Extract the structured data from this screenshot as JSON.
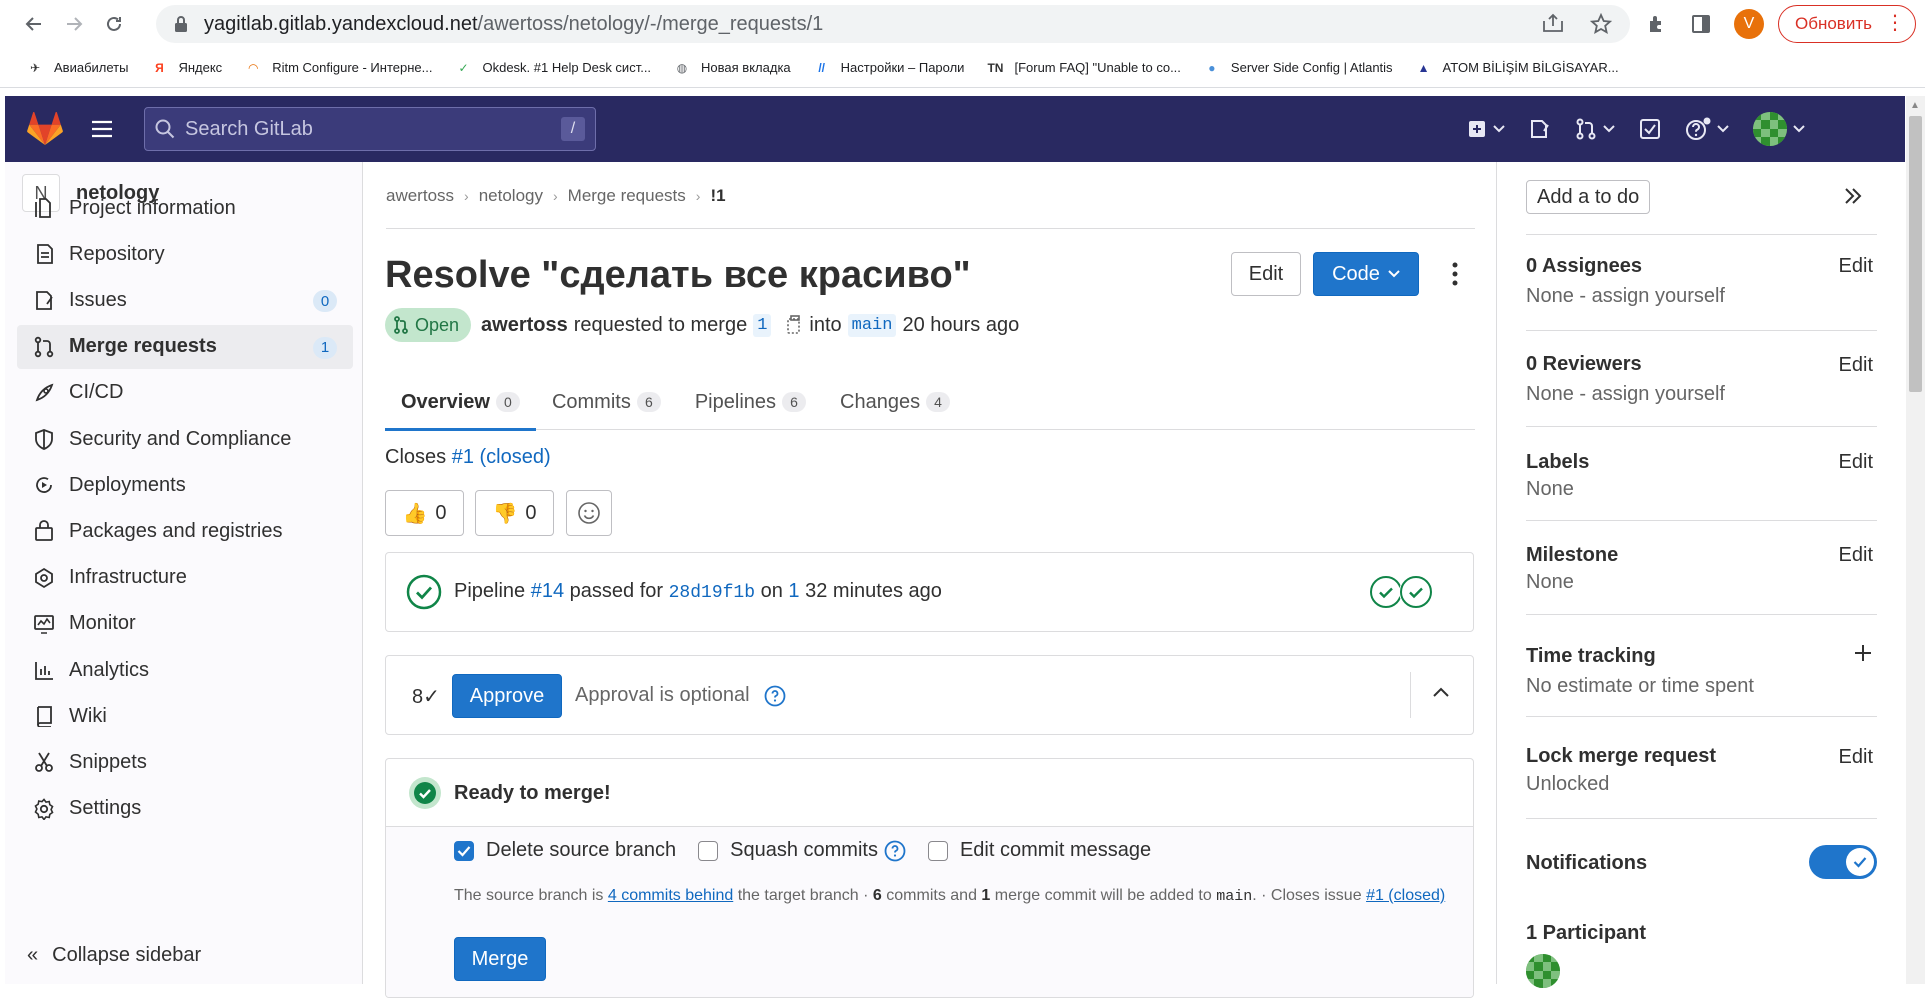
{
  "browser": {
    "url_host": "yagitlab.gitlab.yandexcloud.net",
    "url_path": "/awertoss/netology/-/merge_requests/1",
    "profile_initial": "V",
    "update_label": "Обновить",
    "bookmarks": [
      {
        "label": "Авиабилеты",
        "icon": "plane-icon",
        "color": "#333333"
      },
      {
        "label": "Яндекс",
        "icon": "yandex-icon",
        "color": "#fc3f1d"
      },
      {
        "label": "Ritm Configure - Интерне...",
        "icon": "rainbow-icon",
        "color": "#e8710a"
      },
      {
        "label": "Okdesk. #1 Help Desk сист...",
        "icon": "check-icon",
        "color": "#34a853"
      },
      {
        "label": "Новая вкладка",
        "icon": "globe-icon",
        "color": "#5f6368"
      },
      {
        "label": "Настройки – Пароли",
        "icon": "key-icon",
        "color": "#1a73e8"
      },
      {
        "label": "[Forum FAQ] \"Unable to co...",
        "icon": "tn-icon",
        "color": "#333333"
      },
      {
        "label": "Server Side Config | Atlantis",
        "icon": "atlantis-icon",
        "color": "#4a90d9"
      },
      {
        "label": "ATOM BİLİŞİM BİLGİSAYAR...",
        "icon": "atom-icon",
        "color": "#283593"
      }
    ]
  },
  "gitlab": {
    "search_placeholder": "Search GitLab",
    "search_shortcut": "/"
  },
  "sidebar": {
    "project_initial": "N",
    "project_name": "netology",
    "items": [
      {
        "label": "Project information",
        "icon": "project-info-icon",
        "badge": null
      },
      {
        "label": "Repository",
        "icon": "repository-icon",
        "badge": null
      },
      {
        "label": "Issues",
        "icon": "issues-icon",
        "badge": "0"
      },
      {
        "label": "Merge requests",
        "icon": "merge-request-icon",
        "badge": "1"
      },
      {
        "label": "CI/CD",
        "icon": "rocket-icon",
        "badge": null
      },
      {
        "label": "Security and Compliance",
        "icon": "shield-icon",
        "badge": null
      },
      {
        "label": "Deployments",
        "icon": "deployments-icon",
        "badge": null
      },
      {
        "label": "Packages and registries",
        "icon": "package-icon",
        "badge": null
      },
      {
        "label": "Infrastructure",
        "icon": "infrastructure-icon",
        "badge": null
      },
      {
        "label": "Monitor",
        "icon": "monitor-icon",
        "badge": null
      },
      {
        "label": "Analytics",
        "icon": "analytics-icon",
        "badge": null
      },
      {
        "label": "Wiki",
        "icon": "book-icon",
        "badge": null
      },
      {
        "label": "Snippets",
        "icon": "scissors-icon",
        "badge": null
      },
      {
        "label": "Settings",
        "icon": "gear-icon",
        "badge": null
      }
    ],
    "collapse_label": "Collapse sidebar"
  },
  "main": {
    "breadcrumb": [
      "awertoss",
      "netology",
      "Merge requests",
      "!1"
    ],
    "title": "Resolve \"сделать все красиво\"",
    "edit_label": "Edit",
    "code_label": "Code",
    "status": "Open",
    "author": "awertoss",
    "requested_text": "requested to merge",
    "source_branch": "1",
    "into_text": "into",
    "target_branch": "main",
    "time_ago": "20 hours ago",
    "tabs": [
      {
        "label": "Overview",
        "count": "0"
      },
      {
        "label": "Commits",
        "count": "6"
      },
      {
        "label": "Pipelines",
        "count": "6"
      },
      {
        "label": "Changes",
        "count": "4"
      }
    ],
    "closes_label": "Closes",
    "closes_link": "#1 (closed)",
    "thumbs_up": "0",
    "thumbs_down": "0",
    "pipeline": {
      "label": "Pipeline",
      "id": "#14",
      "passed_for": "passed for",
      "sha": "28d19f1b",
      "on": "on",
      "branch": "1",
      "time": "32 minutes ago"
    },
    "approval": {
      "approvers_icon": "8✓",
      "approve_label": "Approve",
      "optional_text": "Approval is optional"
    },
    "ready": {
      "title": "Ready to merge!",
      "delete_source": "Delete source branch",
      "squash": "Squash commits",
      "edit_message": "Edit commit message",
      "desc_1": "The source branch is",
      "behind_link": "4 commits behind",
      "desc_2": "the target branch ·",
      "commits_count": "6",
      "desc_3": "commits and",
      "merge_commit_count": "1",
      "desc_4": "merge commit will be added to",
      "target": "main",
      "desc_5": ". · Closes issue",
      "issue_link": "#1 (closed)",
      "merge_label": "Merge"
    }
  },
  "right_sidebar": {
    "todo_label": "Add a to do",
    "assignees_title": "0 Assignees",
    "assignees_value": "None - assign yourself",
    "reviewers_title": "0 Reviewers",
    "reviewers_value": "None - assign yourself",
    "labels_title": "Labels",
    "labels_value": "None",
    "milestone_title": "Milestone",
    "milestone_value": "None",
    "time_title": "Time tracking",
    "time_value": "No estimate or time spent",
    "lock_title": "Lock merge request",
    "lock_value": "Unlocked",
    "notifications_title": "Notifications",
    "notifications_on": true,
    "participants_title": "1 Participant",
    "edit_label": "Edit"
  },
  "colors": {
    "nav_bg": "#292961",
    "primary": "#1f75cb",
    "success": "#108548",
    "open_pill_bg": "#c3e6cd"
  }
}
